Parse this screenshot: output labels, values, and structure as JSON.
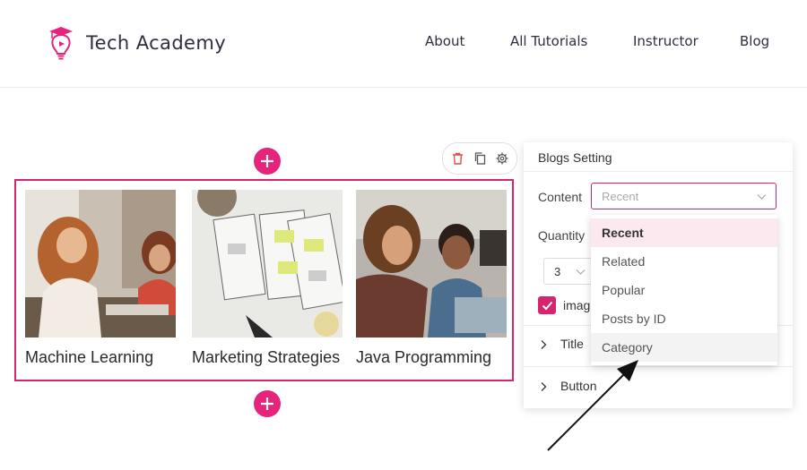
{
  "brand": {
    "name": "Tech Academy",
    "logo_icon": "graduation-bulb-icon",
    "accent": "#e6247c"
  },
  "nav": {
    "items": [
      "About",
      "All Tutorials",
      "Instructor",
      "Blog"
    ]
  },
  "section": {
    "border_color": "#d6246e",
    "cards": [
      {
        "title": "Machine Learning"
      },
      {
        "title": "Marketing Strategies"
      },
      {
        "title": "Java Programming"
      }
    ]
  },
  "toolbar": {
    "icons": [
      "trash-icon",
      "copy-icon",
      "gear-icon"
    ]
  },
  "panel": {
    "title": "Blogs Setting",
    "content_label": "Content",
    "content_value": "Recent",
    "quantity_label": "Quantity",
    "quantity_value": "3",
    "checkbox_label": "imag",
    "accordions": [
      "Title",
      "Button"
    ]
  },
  "dropdown": {
    "options": [
      "Recent",
      "Related",
      "Popular",
      "Posts by ID",
      "Category"
    ],
    "selected": "Recent",
    "hovered": "Category"
  }
}
